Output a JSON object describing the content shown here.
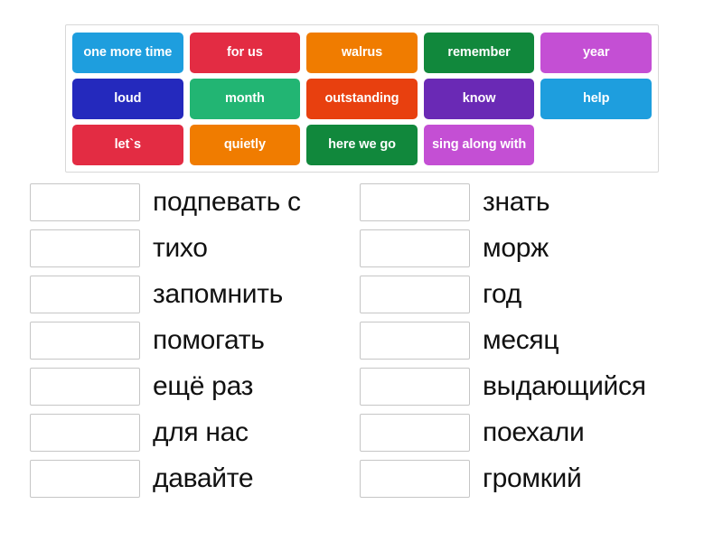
{
  "word_bank": {
    "rows": [
      [
        {
          "label": "one more time",
          "color": "#1e9ede"
        },
        {
          "label": "for us",
          "color": "#e32c43"
        },
        {
          "label": "walrus",
          "color": "#f07c00"
        },
        {
          "label": "remember",
          "color": "#11883c"
        },
        {
          "label": "year",
          "color": "#c44fd4"
        }
      ],
      [
        {
          "label": "loud",
          "color": "#2429bd"
        },
        {
          "label": "month",
          "color": "#22b573"
        },
        {
          "label": "outstanding",
          "color": "#e8400f"
        },
        {
          "label": "know",
          "color": "#6a29b5"
        },
        {
          "label": "help",
          "color": "#1e9ede"
        }
      ],
      [
        {
          "label": "let`s",
          "color": "#e32c43"
        },
        {
          "label": "quietly",
          "color": "#f07c00"
        },
        {
          "label": "here we go",
          "color": "#11883c"
        },
        {
          "label": "sing along with",
          "color": "#c44fd4"
        },
        {
          "label": "",
          "color": "",
          "empty": true
        }
      ]
    ]
  },
  "answers": {
    "left_column": [
      {
        "box_value": "",
        "label": "подпевать с"
      },
      {
        "box_value": "",
        "label": "тихо"
      },
      {
        "box_value": "",
        "label": "запомнить"
      },
      {
        "box_value": "",
        "label": "помогать"
      },
      {
        "box_value": "",
        "label": "ещё раз"
      },
      {
        "box_value": "",
        "label": "для нас"
      },
      {
        "box_value": "",
        "label": "давайте"
      }
    ],
    "right_column": [
      {
        "box_value": "",
        "label": "знать"
      },
      {
        "box_value": "",
        "label": "морж"
      },
      {
        "box_value": "",
        "label": "год"
      },
      {
        "box_value": "",
        "label": "месяц"
      },
      {
        "box_value": "",
        "label": "выдающийся"
      },
      {
        "box_value": "",
        "label": "поехали"
      },
      {
        "box_value": "",
        "label": "громкий"
      }
    ]
  }
}
